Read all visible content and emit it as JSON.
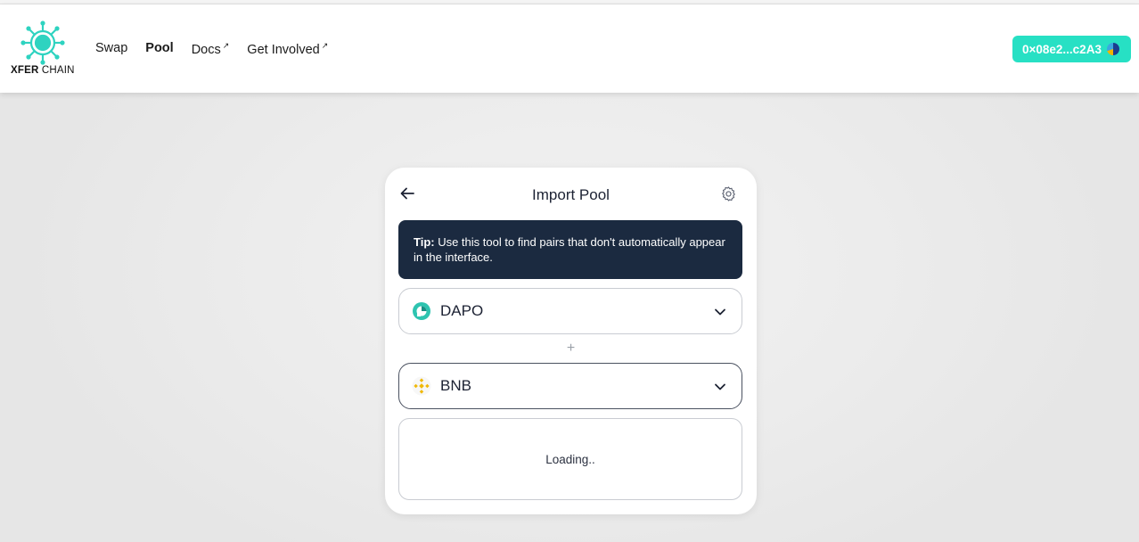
{
  "brand": {
    "name_bold": "XFER",
    "name_rest": " CHAIN",
    "logo_color": "#2ed3c0"
  },
  "nav": {
    "items": [
      {
        "label": "Swap",
        "external": false
      },
      {
        "label": "Pool",
        "external": false
      },
      {
        "label": "Docs",
        "external": true
      },
      {
        "label": "Get Involved",
        "external": true
      }
    ],
    "external_mark": "↗"
  },
  "wallet": {
    "address": "0×08e2...c2A3",
    "color": "#27e0c4"
  },
  "import_pool": {
    "title": "Import Pool",
    "tip_label": "Tip:",
    "tip_text": " Use this tool to find pairs that don't automatically appear in the interface.",
    "token_a": {
      "symbol": "DAPO",
      "icon": "dapo-token-icon"
    },
    "token_b": {
      "symbol": "BNB",
      "icon": "bnb-token-icon"
    },
    "plus": "+",
    "status": "Loading.."
  }
}
